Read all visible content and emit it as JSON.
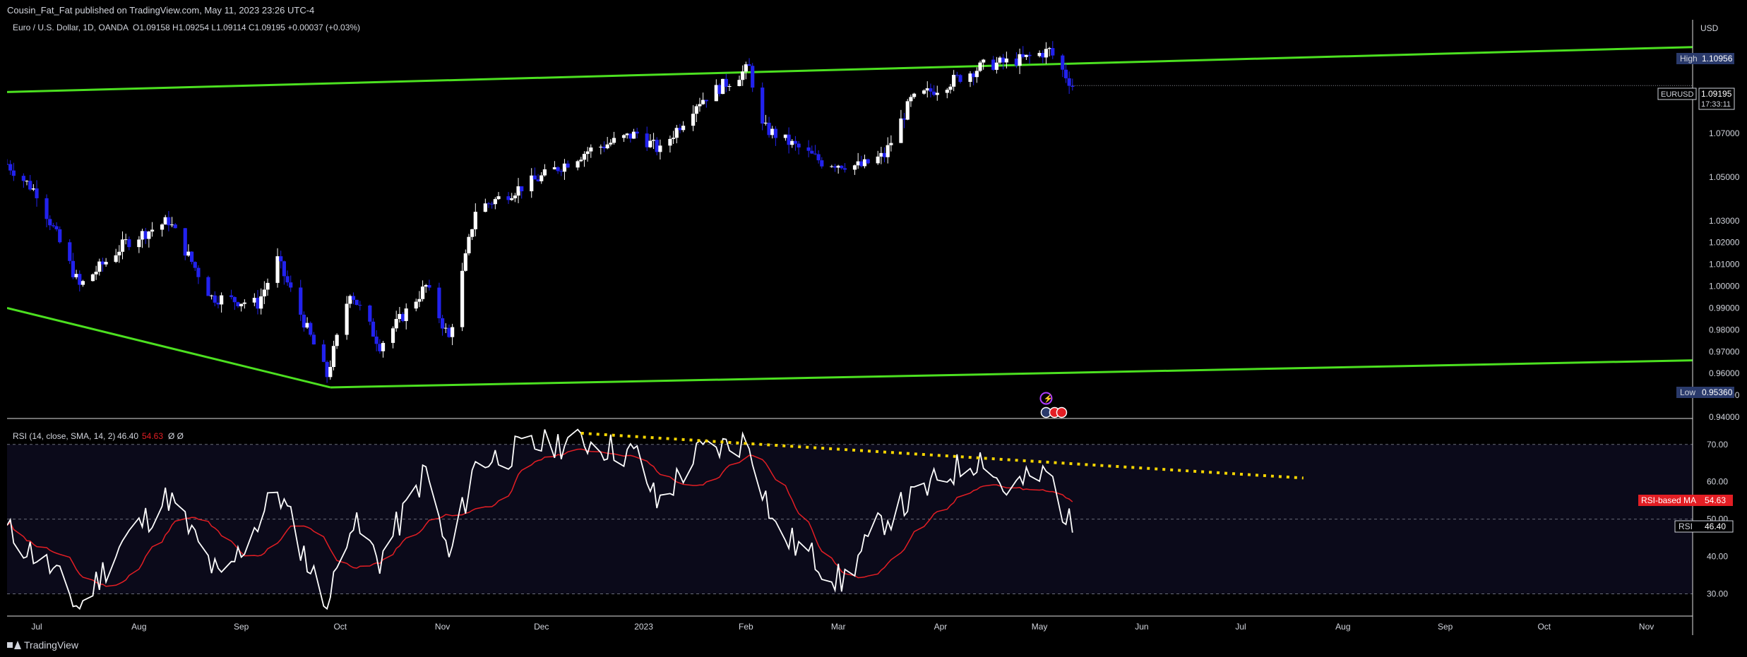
{
  "header": {
    "published": "Cousin_Fat_Fat published on TradingView.com, May 11, 2023 23:26 UTC-4"
  },
  "legend": {
    "symbol": "Euro / U.S. Dollar, 1D, OANDA",
    "ohlc": "O1.09158 H1.09254 L1.09114 C1.09195 +0.00037 (+0.03%)"
  },
  "rsi_legend": {
    "label": "RSI (14, close, SMA, 14, 2)",
    "rsi_value": "46.40",
    "ma_value": "54.63",
    "extra": "Ø Ø"
  },
  "price_axis": {
    "currency": "USD",
    "ticks": [
      "1.07000",
      "1.05000",
      "1.03000",
      "1.02000",
      "1.01000",
      "1.00000",
      "0.99000",
      "0.98000",
      "0.97000",
      "0.96000",
      "0.95000",
      "0.94000"
    ],
    "high_label": "High",
    "high_value": "1.10956",
    "low_label": "Low",
    "low_value": "0.95360",
    "symbol_label": "EURUSD",
    "last_price": "1.09195",
    "countdown": "17:33:11"
  },
  "rsi_axis": {
    "ticks": [
      "70.00",
      "60.00",
      "50.00",
      "40.00",
      "30.00"
    ],
    "ma_label": "RSI-based MA",
    "ma_value": "54.63",
    "rsi_label": "RSI",
    "rsi_value": "46.40"
  },
  "time_axis": {
    "labels": [
      "Jul",
      "Aug",
      "Sep",
      "Oct",
      "Nov",
      "Dec",
      "2023",
      "Feb",
      "Mar",
      "Apr",
      "May",
      "Jun",
      "Jul",
      "Aug",
      "Sep",
      "Oct",
      "Nov"
    ]
  },
  "brand": {
    "name": "TradingView"
  },
  "colors": {
    "bg": "#000000",
    "up": "#ffffff",
    "down": "#2222ee",
    "trendline": "#4ce020",
    "rsi_line": "#ffffff",
    "rsi_ma": "#e31e24",
    "rsi_trend": "#f5d400",
    "rsi_band": "#0b0a1a",
    "badge_blue": "#2a3a6b",
    "badge_red": "#e31e24"
  },
  "chart_data": {
    "type": "candlestick",
    "symbol": "EURUSD",
    "interval": "1D",
    "ylim": [
      0.94,
      1.115
    ],
    "x_range": [
      "2022-06-22",
      "2023-11-15"
    ],
    "anchor_points": [
      {
        "date": "2022-06-22",
        "close": 1.056
      },
      {
        "date": "2022-07-01",
        "close": 1.043
      },
      {
        "date": "2022-07-14",
        "close": 1.0
      },
      {
        "date": "2022-07-28",
        "close": 1.02
      },
      {
        "date": "2022-08-10",
        "close": 1.03
      },
      {
        "date": "2022-08-23",
        "close": 0.995
      },
      {
        "date": "2022-09-06",
        "close": 0.992
      },
      {
        "date": "2022-09-12",
        "close": 1.012
      },
      {
        "date": "2022-09-27",
        "close": 0.959
      },
      {
        "date": "2022-10-04",
        "close": 0.998
      },
      {
        "date": "2022-10-13",
        "close": 0.973
      },
      {
        "date": "2022-10-27",
        "close": 1.0
      },
      {
        "date": "2022-11-03",
        "close": 0.976
      },
      {
        "date": "2022-11-11",
        "close": 1.035
      },
      {
        "date": "2022-12-01",
        "close": 1.05
      },
      {
        "date": "2022-12-15",
        "close": 1.062
      },
      {
        "date": "2022-12-30",
        "close": 1.07
      },
      {
        "date": "2023-01-06",
        "close": 1.062
      },
      {
        "date": "2023-01-17",
        "close": 1.084
      },
      {
        "date": "2023-02-02",
        "close": 1.1
      },
      {
        "date": "2023-02-06",
        "close": 1.073
      },
      {
        "date": "2023-02-24",
        "close": 1.057
      },
      {
        "date": "2023-03-08",
        "close": 1.055
      },
      {
        "date": "2023-03-15",
        "close": 1.06
      },
      {
        "date": "2023-03-23",
        "close": 1.085
      },
      {
        "date": "2023-04-14",
        "close": 1.101
      },
      {
        "date": "2023-04-26",
        "close": 1.104
      },
      {
        "date": "2023-05-04",
        "close": 1.108
      },
      {
        "date": "2023-05-11",
        "close": 1.09195
      }
    ],
    "trendlines": [
      {
        "from": {
          "date": "2022-06-22",
          "price": 1.089
        },
        "to": {
          "date": "2023-11-15",
          "price": 1.1096
        }
      },
      {
        "from": {
          "date": "2022-06-22",
          "price": 0.99
        },
        "to": {
          "date": "2022-09-28",
          "price": 0.9536
        }
      },
      {
        "from": {
          "date": "2022-09-28",
          "price": 0.9536
        },
        "to": {
          "date": "2023-11-15",
          "price": 0.966
        }
      }
    ],
    "rsi": {
      "ylim": [
        25,
        76
      ],
      "levels": [
        70,
        50,
        30
      ],
      "anchors": [
        {
          "date": "2022-06-22",
          "rsi": 47
        },
        {
          "date": "2022-07-05",
          "rsi": 37
        },
        {
          "date": "2022-07-14",
          "rsi": 26
        },
        {
          "date": "2022-07-26",
          "rsi": 43
        },
        {
          "date": "2022-08-10",
          "rsi": 56
        },
        {
          "date": "2022-08-26",
          "rsi": 33
        },
        {
          "date": "2022-09-12",
          "rsi": 58
        },
        {
          "date": "2022-09-27",
          "rsi": 26
        },
        {
          "date": "2022-10-04",
          "rsi": 50
        },
        {
          "date": "2022-10-13",
          "rsi": 39
        },
        {
          "date": "2022-10-27",
          "rsi": 63
        },
        {
          "date": "2022-11-03",
          "rsi": 39
        },
        {
          "date": "2022-11-11",
          "rsi": 65
        },
        {
          "date": "2022-12-01",
          "rsi": 70
        },
        {
          "date": "2022-12-14",
          "rsi": 71
        },
        {
          "date": "2022-12-30",
          "rsi": 67
        },
        {
          "date": "2023-01-05",
          "rsi": 54
        },
        {
          "date": "2023-01-18",
          "rsi": 68
        },
        {
          "date": "2023-02-02",
          "rsi": 71
        },
        {
          "date": "2023-02-10",
          "rsi": 47
        },
        {
          "date": "2023-02-24",
          "rsi": 38
        },
        {
          "date": "2023-03-02",
          "rsi": 33
        },
        {
          "date": "2023-03-15",
          "rsi": 50
        },
        {
          "date": "2023-04-05",
          "rsi": 63
        },
        {
          "date": "2023-04-14",
          "rsi": 67
        },
        {
          "date": "2023-04-20",
          "rsi": 58
        },
        {
          "date": "2023-05-04",
          "rsi": 62
        },
        {
          "date": "2023-05-11",
          "rsi": 46.4
        }
      ],
      "ma_last": 54.63,
      "trendline": {
        "from": {
          "date": "2022-12-13",
          "rsi": 73
        },
        "to": {
          "date": "2023-07-20",
          "rsi": 61
        }
      }
    }
  }
}
